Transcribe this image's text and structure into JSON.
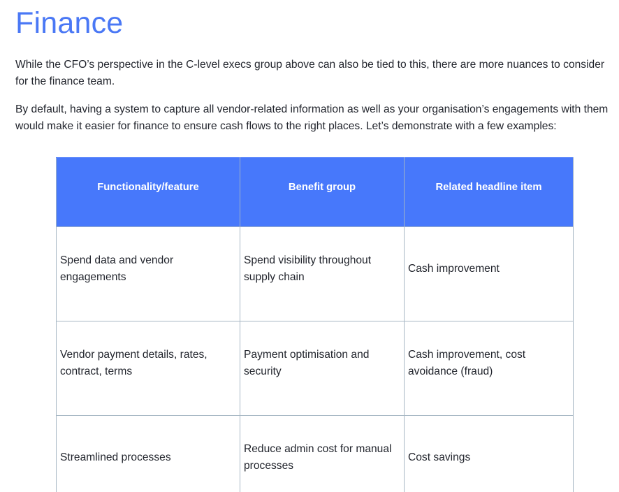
{
  "heading": "Finance",
  "paragraphs": [
    "While the CFO’s perspective in the C-level execs group above can also be tied to this, there are more nuances to consider for the finance team.",
    "By default, having a system to capture all vendor-related information as well as your organisation’s engagements with them would make it easier for finance to ensure cash flows to the right places. Let’s demonstrate with a few examples:"
  ],
  "table": {
    "headers": [
      "Functionality/feature",
      "Benefit group",
      "Related headline item"
    ],
    "rows": [
      [
        "Spend data and vendor engagements",
        "Spend visibility throughout supply chain",
        "Cash improvement"
      ],
      [
        "Vendor payment details, rates, contract, terms",
        "Payment optimisation and security",
        "Cash improvement, cost avoidance (fraud)"
      ],
      [
        "Streamlined processes",
        "Reduce admin cost for manual processes",
        "Cost savings"
      ]
    ]
  },
  "colors": {
    "heading": "#4a78f5",
    "table_header_bg": "#4778fb",
    "table_header_text": "#ffffff",
    "table_border": "#a7b7c4"
  }
}
